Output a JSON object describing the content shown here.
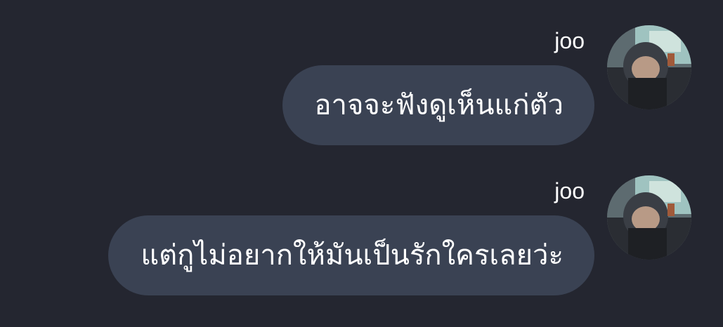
{
  "chat": {
    "messages": [
      {
        "sender": "joo",
        "text": "อาจจะฟังดูเห็นแก่ตัว",
        "avatar_icon": "user-avatar-photo"
      },
      {
        "sender": "joo",
        "text": "แต่กูไม่อยากให้มันเป็นรักใครเลยว่ะ",
        "avatar_icon": "user-avatar-photo"
      }
    ]
  },
  "colors": {
    "background": "#242630",
    "bubble": "#3a4253",
    "text": "#ffffff"
  }
}
